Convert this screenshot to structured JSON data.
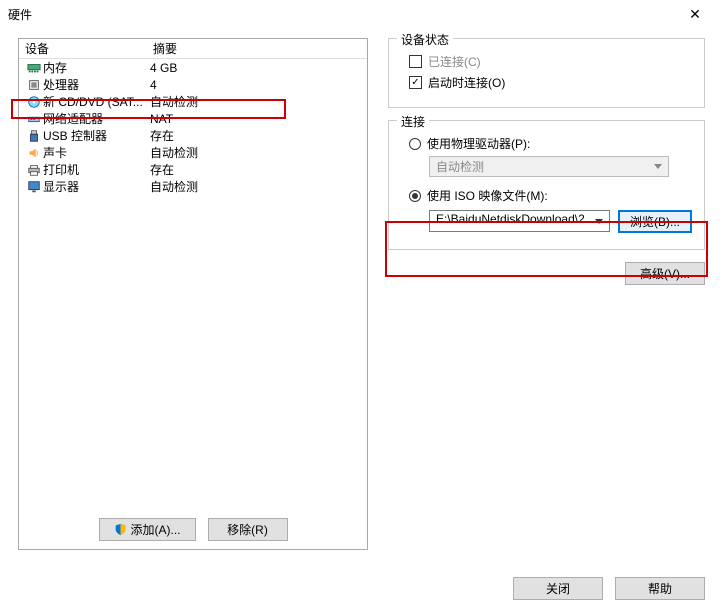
{
  "title": "硬件",
  "left": {
    "headers": {
      "device": "设备",
      "summary": "摘要"
    },
    "rows": [
      {
        "name": "内存",
        "summary": "4 GB",
        "icon": "memory"
      },
      {
        "name": "处理器",
        "summary": "4",
        "icon": "cpu"
      },
      {
        "name": "新 CD/DVD (SAT...",
        "summary": "自动检测",
        "icon": "disc",
        "selected": true
      },
      {
        "name": "网络适配器",
        "summary": "NAT",
        "icon": "network"
      },
      {
        "name": "USB 控制器",
        "summary": "存在",
        "icon": "usb"
      },
      {
        "name": "声卡",
        "summary": "自动检测",
        "icon": "sound"
      },
      {
        "name": "打印机",
        "summary": "存在",
        "icon": "printer"
      },
      {
        "name": "显示器",
        "summary": "自动检测",
        "icon": "display"
      }
    ],
    "buttons": {
      "add": "添加(A)...",
      "remove": "移除(R)"
    }
  },
  "right": {
    "status": {
      "legend": "设备状态",
      "connected": {
        "label": "已连接(C)",
        "checked": false,
        "enabled": false
      },
      "connectAtPower": {
        "label": "启动时连接(O)",
        "checked": true
      }
    },
    "connection": {
      "legend": "连接",
      "physical": {
        "label": "使用物理驱动器(P):",
        "checked": false
      },
      "autoDetect": "自动检测",
      "iso": {
        "label": "使用 ISO 映像文件(M):",
        "checked": true
      },
      "isoPath": "E:\\BaiduNetdiskDownload\\2",
      "browse": "浏览(B)..."
    },
    "advanced": "高级(V)..."
  },
  "footer": {
    "close": "关闭",
    "help": "帮助"
  }
}
